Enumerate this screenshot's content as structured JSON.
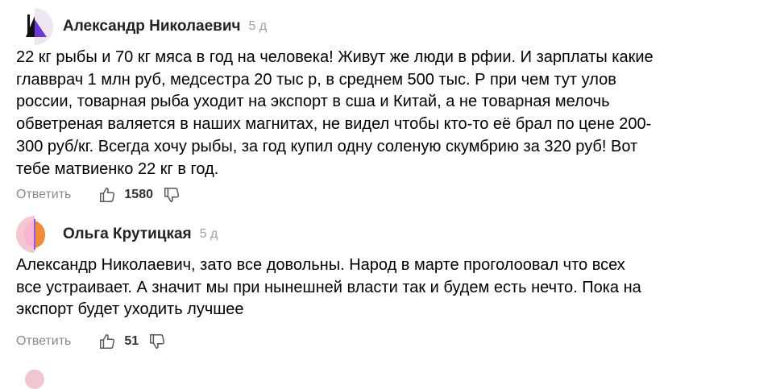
{
  "comments": [
    {
      "author": "Александр Николаевич",
      "age": "5 д",
      "lines": [
        "22 кг рыбы и 70 кг мяса в год на человека! Живут же люди в рфии. И зарплаты какие",
        "главврач 1 млн руб, медсестра 20 тыс р, в среднем 500 тыс. Р при чем тут улов",
        "россии, товарная рыба уходит на экспорт в сша и Китай, а не товарная мелочь",
        "обветреная валяется в наших магнитах, не видел чтобы кто-то её брал по цене 200-",
        "300 руб/кг. Всегда хочу рыбы, за год купил одну соленую скумбрию за 320 руб! Вот",
        "тебе матвиенко 22 кг в год."
      ],
      "reply_label": "Ответить",
      "likes": "1580"
    },
    {
      "author": "Ольга Крутицкая",
      "age": "5 д",
      "lines": [
        "Александр Николаевич, зато все довольны. Народ в марте проголоовал что всех",
        "все устраивает. А значит мы при нынешней власти так и будем есть нечто. Пока на",
        "экспорт будет уходить лучшее"
      ],
      "reply_label": "Ответить",
      "likes": "51"
    }
  ],
  "icons": {
    "like": "thumbs-up-icon",
    "dislike": "thumbs-down-icon"
  },
  "colors": {
    "author": "#222222",
    "meta": "#a0a0a0",
    "reply": "#8a8a8a"
  }
}
